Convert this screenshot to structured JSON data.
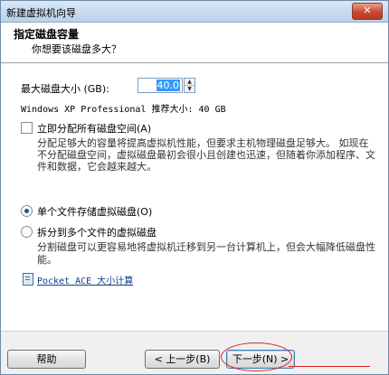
{
  "window": {
    "title": "新建虚拟机向导",
    "close_glyph": "✕"
  },
  "header": {
    "title": "指定磁盘容量",
    "subtitle": "你想要该磁盘多大？"
  },
  "disk": {
    "size_label": "最大磁盘大小 (GB):",
    "size_value": "40.0",
    "recommend": "Windows XP Professional 推荐大小: 40 GB",
    "allocate_label": "立即分配所有磁盘空间(A)",
    "allocate_checked": false,
    "allocate_desc": "分配足够大的容量将提高虚拟机性能，但要求主机物理磁盘足够大。 如现在不分配磁盘空间，虚拟磁盘最初会很小且创建也迅速，但随着你添加程序、文件和数据，它会越来越大。",
    "single_file_label": "单个文件存储虚拟磁盘(O)",
    "split_label": "拆分到多个文件的虚拟磁盘",
    "split_desc": "分割磁盘可以更容易地将虚拟机迁移到另一台计算机上，但会大幅降低磁盘性能。",
    "selected_option": "single"
  },
  "link": {
    "text": "Pocket ACE 大小计算"
  },
  "buttons": {
    "help": "帮助",
    "back": "< 上一步(B)",
    "next": "下一步(N) >",
    "cancel": ""
  },
  "colors": {
    "annotation": "#e02020",
    "selection": "#3399ff"
  }
}
